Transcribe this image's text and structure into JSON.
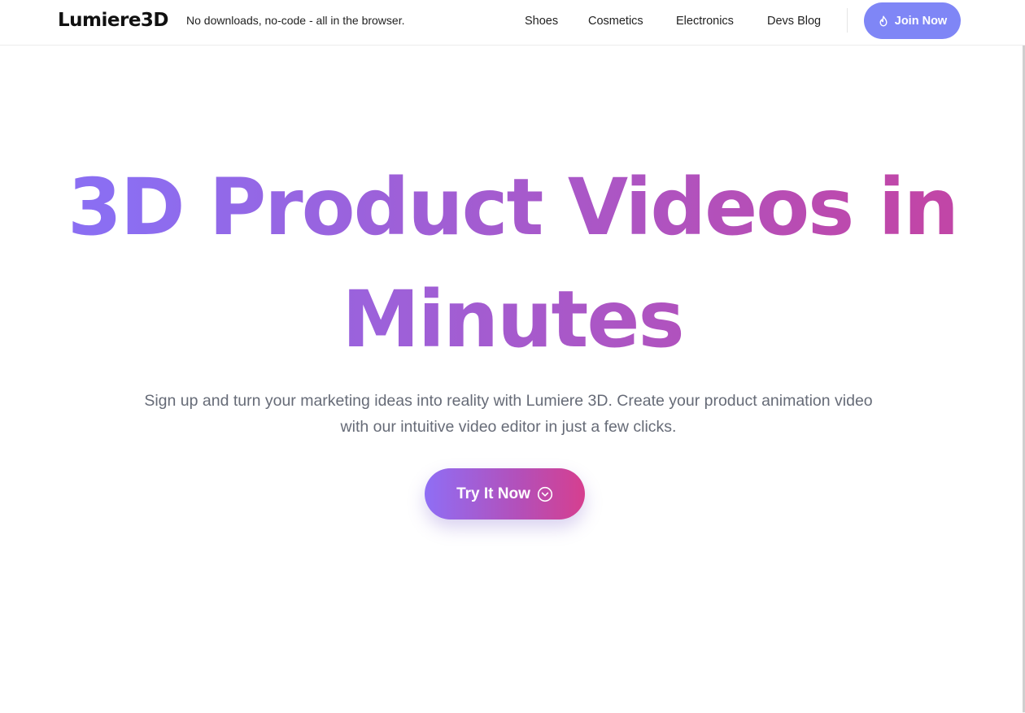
{
  "header": {
    "logo": "Lumiere3D",
    "tagline": "No downloads, no-code - all in the browser.",
    "nav": [
      {
        "label": "Shoes"
      },
      {
        "label": "Cosmetics"
      },
      {
        "label": "Electronics"
      },
      {
        "label": "Devs Blog"
      }
    ],
    "join_button": {
      "label": "Join Now",
      "icon": "flame-icon",
      "color": "#7f86f6"
    }
  },
  "hero": {
    "title_line1": "3D Product Videos in",
    "title_line2": "Minutes",
    "title_gradient": [
      "#8b6ef2",
      "#c146a7"
    ],
    "subtitle": "Sign up and turn your marketing ideas into reality with Lumiere 3D. Create your product animation video with our intuitive video editor in just a few clicks.",
    "cta": {
      "label": "Try It Now",
      "icon": "chevron-down-circle-icon",
      "gradient": [
        "#8f6ef5",
        "#d63f8f"
      ]
    }
  }
}
